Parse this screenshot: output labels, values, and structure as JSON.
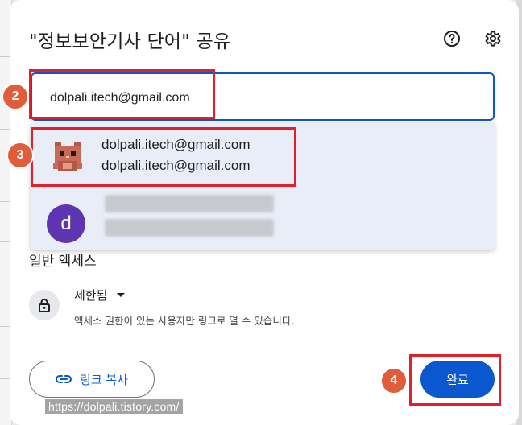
{
  "dialog": {
    "title": "\"정보보안기사 단어\" 공유",
    "help_icon": "help-circle-icon",
    "settings_icon": "gear-icon"
  },
  "email_input": {
    "value": "dolpali.itech@gmail.com"
  },
  "suggestions": [
    {
      "name": "dolpali.itech@gmail.com",
      "email": "dolpali.itech@gmail.com",
      "avatar": "cat-avatar"
    },
    {
      "avatar_letter": "d",
      "avatar_color": "#5e35b1"
    }
  ],
  "general_access": {
    "label": "일반 액세스",
    "level": "제한됨",
    "description": "액세스 권한이 있는 사용자만 링크로 열 수 있습니다.",
    "icon": "lock-icon"
  },
  "footer": {
    "copy_link_label": "링크 복사",
    "copy_link_icon": "link-icon",
    "done_label": "완료"
  },
  "annotations": {
    "step2": "2",
    "step3": "3",
    "step4": "4"
  },
  "watermark": "https://dolpali.tistory.com/",
  "colors": {
    "accent": "#0b57d0",
    "highlight": "#e1202c",
    "badge": "#e05c3a",
    "suggestion_bg": "#e9edf7"
  }
}
